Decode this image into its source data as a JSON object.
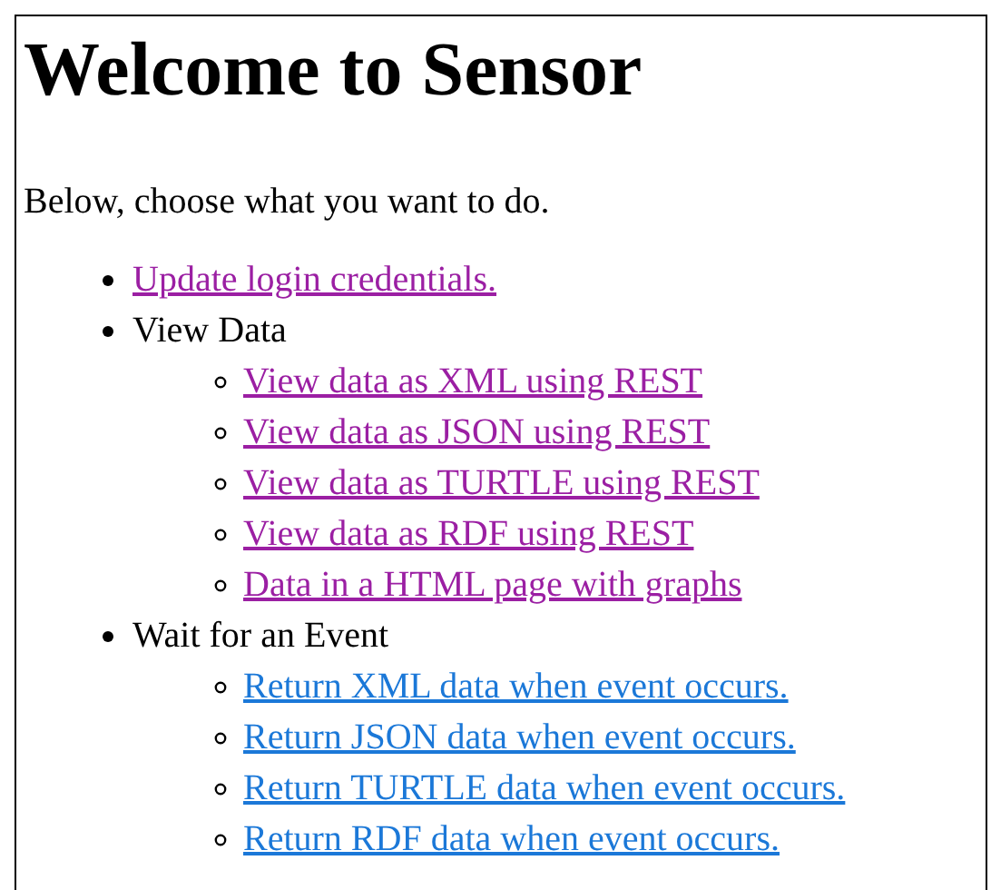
{
  "heading": "Welcome to Sensor",
  "intro": "Below, choose what you want to do.",
  "menu": [
    {
      "label": "Update login credentials.",
      "kind": "link",
      "visited": true
    },
    {
      "label": "View Data",
      "kind": "text",
      "children": [
        {
          "label": "View data as XML using REST",
          "visited": true
        },
        {
          "label": "View data as JSON using REST",
          "visited": true
        },
        {
          "label": "View data as TURTLE using REST",
          "visited": true
        },
        {
          "label": "View data as RDF using REST",
          "visited": true
        },
        {
          "label": "Data in a HTML page with graphs",
          "visited": true
        }
      ]
    },
    {
      "label": "Wait for an Event",
      "kind": "text",
      "children": [
        {
          "label": "Return XML data when event occurs.",
          "visited": false
        },
        {
          "label": "Return JSON data when event occurs.",
          "visited": false
        },
        {
          "label": "Return TURTLE data when event occurs.",
          "visited": false
        },
        {
          "label": "Return RDF data when event occurs.",
          "visited": false
        }
      ]
    }
  ]
}
